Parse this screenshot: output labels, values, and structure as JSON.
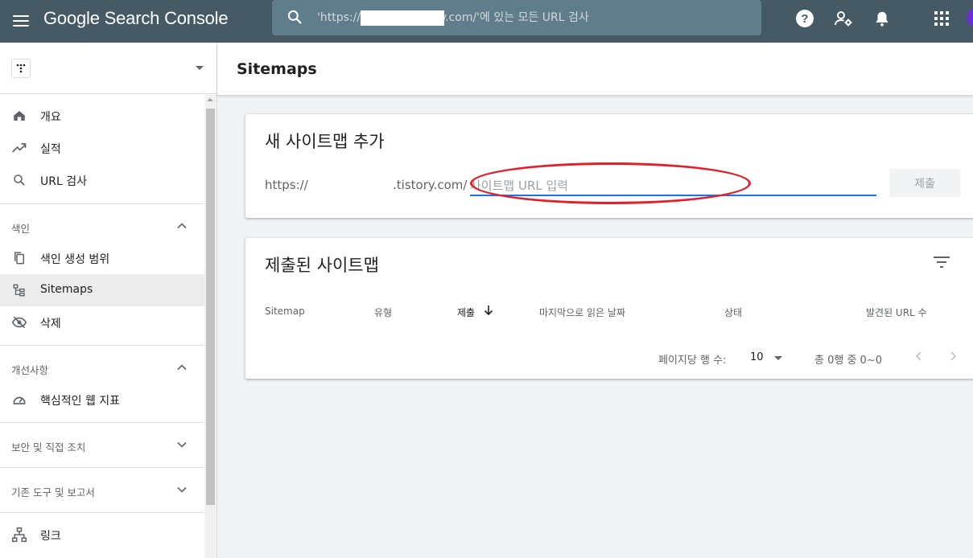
{
  "app": {
    "title": "Google Search Console"
  },
  "search": {
    "placeholder": "'https://              tistory.com/'에 있는 모든 URL 검사"
  },
  "header_icons": [
    "help-icon",
    "manage-accounts-icon",
    "notifications-icon",
    "apps-icon"
  ],
  "sidebar": {
    "property_name": ""
  },
  "nav": {
    "overview": "개요",
    "performance": "실적",
    "url_inspection": "URL 검사",
    "index_section": "색인",
    "coverage": "색인 생성 범위",
    "sitemaps": "Sitemaps",
    "removals": "삭제",
    "enhancements_section": "개선사항",
    "web_vitals": "핵심적인 웹 지표",
    "security_section": "보안 및 직접 조치",
    "legacy_section": "기존 도구 및 보고서",
    "links": "링크"
  },
  "main": {
    "page_title": "Sitemaps",
    "add_card": {
      "title": "새 사이트맵 추가",
      "prefix_scheme": "https://",
      "prefix_domain": ".tistory.com/",
      "input_placeholder": "사이트맵 URL 입력",
      "submit_label": "제출"
    },
    "submitted_card": {
      "title": "제출된 사이트맵",
      "columns": [
        "Sitemap",
        "유형",
        "제출",
        "마지막으로 읽은 날짜",
        "상태",
        "발견된 URL 수"
      ],
      "rows_per_page_label": "페이지당 행 수:",
      "rows_per_page_value": "10",
      "range_label": "총 0행 중 0~0"
    }
  },
  "colors": {
    "topbar": "#455a64",
    "search_bg": "#607d8b",
    "accent": "#1a73e8",
    "annotation_circle": "#e0202a"
  }
}
